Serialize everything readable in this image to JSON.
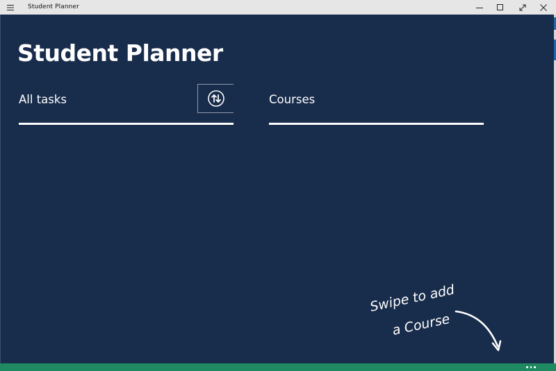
{
  "window": {
    "title": "Student Planner",
    "menu_icon": "hamburger-icon",
    "controls": [
      "minimize-icon",
      "maximize-icon",
      "fullscreen-icon",
      "close-icon"
    ]
  },
  "page": {
    "title": "Student Planner"
  },
  "sections": {
    "tasks": {
      "label": "All tasks",
      "sort_icon": "sort-up-down-icon"
    },
    "courses": {
      "label": "Courses"
    }
  },
  "hint": {
    "line1": "Swipe to add",
    "line2": "a Course",
    "icon": "curved-arrow-icon"
  },
  "appbar": {
    "more_icon": "ellipsis-icon"
  },
  "colors": {
    "background": "#182c4b",
    "titlebar": "#e6e6e6",
    "appbar": "#1f8a62",
    "text": "#ffffff"
  }
}
